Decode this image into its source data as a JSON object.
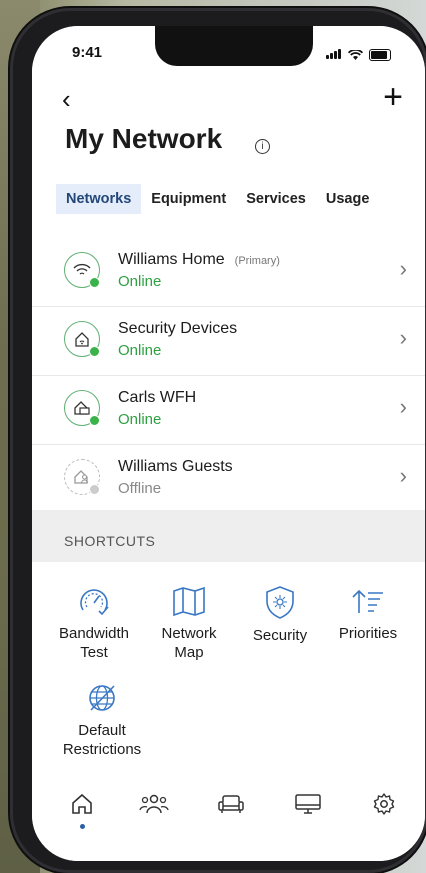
{
  "status_bar": {
    "time": "9:41"
  },
  "header": {
    "back_icon": "chevron-left-icon",
    "add_icon": "plus-icon",
    "title": "My Network",
    "info_icon": "info-icon"
  },
  "tabs": [
    {
      "label": "Networks",
      "active": true
    },
    {
      "label": "Equipment",
      "active": false
    },
    {
      "label": "Services",
      "active": false
    },
    {
      "label": "Usage",
      "active": false
    }
  ],
  "networks": [
    {
      "name": "Williams Home",
      "tag": "(Primary)",
      "status": "Online",
      "icon": "wifi-icon"
    },
    {
      "name": "Security Devices",
      "tag": "",
      "status": "Online",
      "icon": "home-security-icon"
    },
    {
      "name": "Carls WFH",
      "tag": "",
      "status": "Online",
      "icon": "home-work-icon"
    },
    {
      "name": "Williams Guests",
      "tag": "",
      "status": "Offline",
      "icon": "guest-icon"
    }
  ],
  "shortcuts": {
    "label": "SHORTCUTS",
    "items": [
      {
        "line1": "Bandwidth",
        "line2": "Test",
        "icon": "speedometer-icon"
      },
      {
        "line1": "Network",
        "line2": "Map",
        "icon": "map-icon"
      },
      {
        "line1": "Security",
        "line2": "",
        "icon": "shield-icon"
      },
      {
        "line1": "Priorities",
        "line2": "",
        "icon": "priority-icon"
      },
      {
        "line1": "Default",
        "line2": "Restrictions",
        "icon": "globe-restriction-icon"
      }
    ]
  },
  "bottom_nav": [
    "home-icon",
    "people-icon",
    "couch-icon",
    "monitor-icon",
    "gear-icon"
  ],
  "colors": {
    "online": "#2ea142",
    "accent": "#2c5fa5",
    "tab_active_bg": "#e4edf9",
    "icon_blue": "#3a78c4"
  }
}
